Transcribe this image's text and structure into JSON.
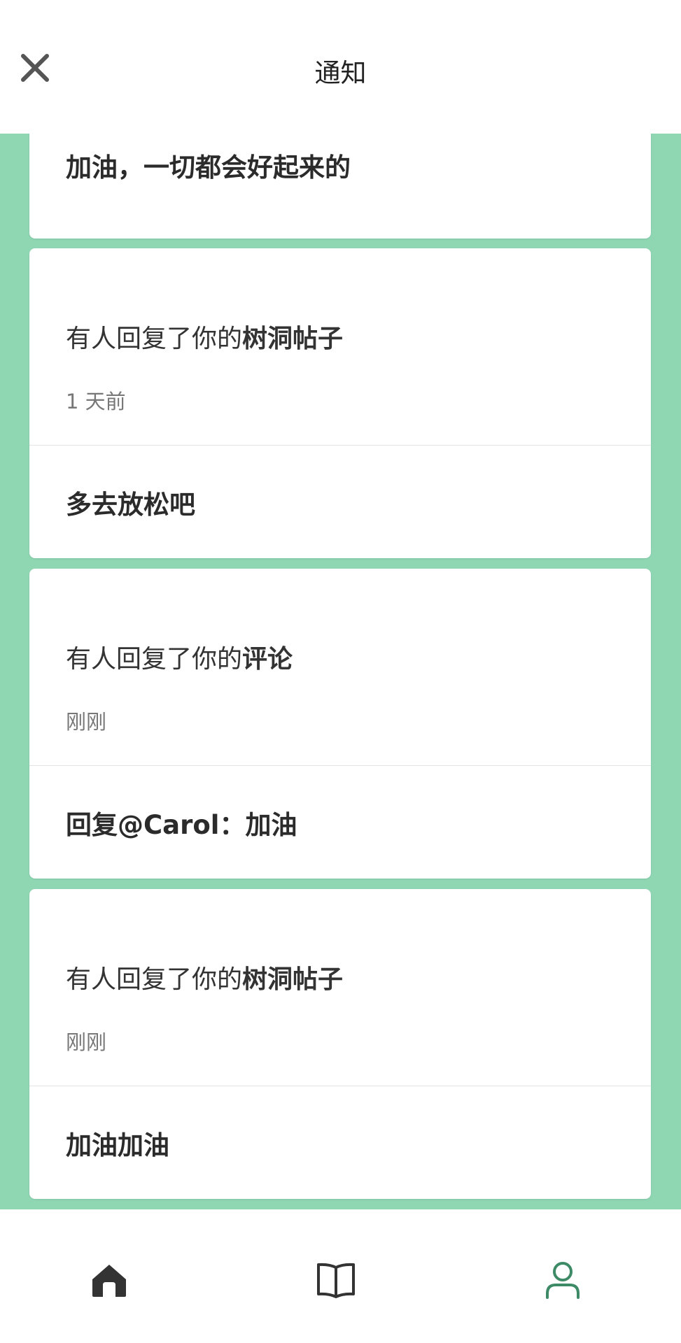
{
  "header": {
    "title": "通知",
    "close_icon": "close-icon"
  },
  "notifications": [
    {
      "heading_prefix": "",
      "heading_bold": "",
      "time": "",
      "reply": "加油，一切都会好起来的"
    },
    {
      "heading_prefix": "有人回复了你的",
      "heading_bold": "树洞帖子",
      "time": "1 天前",
      "reply": "多去放松吧"
    },
    {
      "heading_prefix": "有人回复了你的",
      "heading_bold": "评论",
      "time": "刚刚",
      "reply": "回复@Carol：加油"
    },
    {
      "heading_prefix": "有人回复了你的",
      "heading_bold": "树洞帖子",
      "time": "刚刚",
      "reply": "加油加油"
    }
  ],
  "bottom_nav": {
    "items": [
      {
        "icon": "home-icon"
      },
      {
        "icon": "book-icon"
      },
      {
        "icon": "user-icon",
        "active": true
      }
    ],
    "active_color": "#3d8a66",
    "inactive_color": "#333333"
  },
  "colors": {
    "background_green": "#8fd6b3",
    "card": "#ffffff"
  }
}
